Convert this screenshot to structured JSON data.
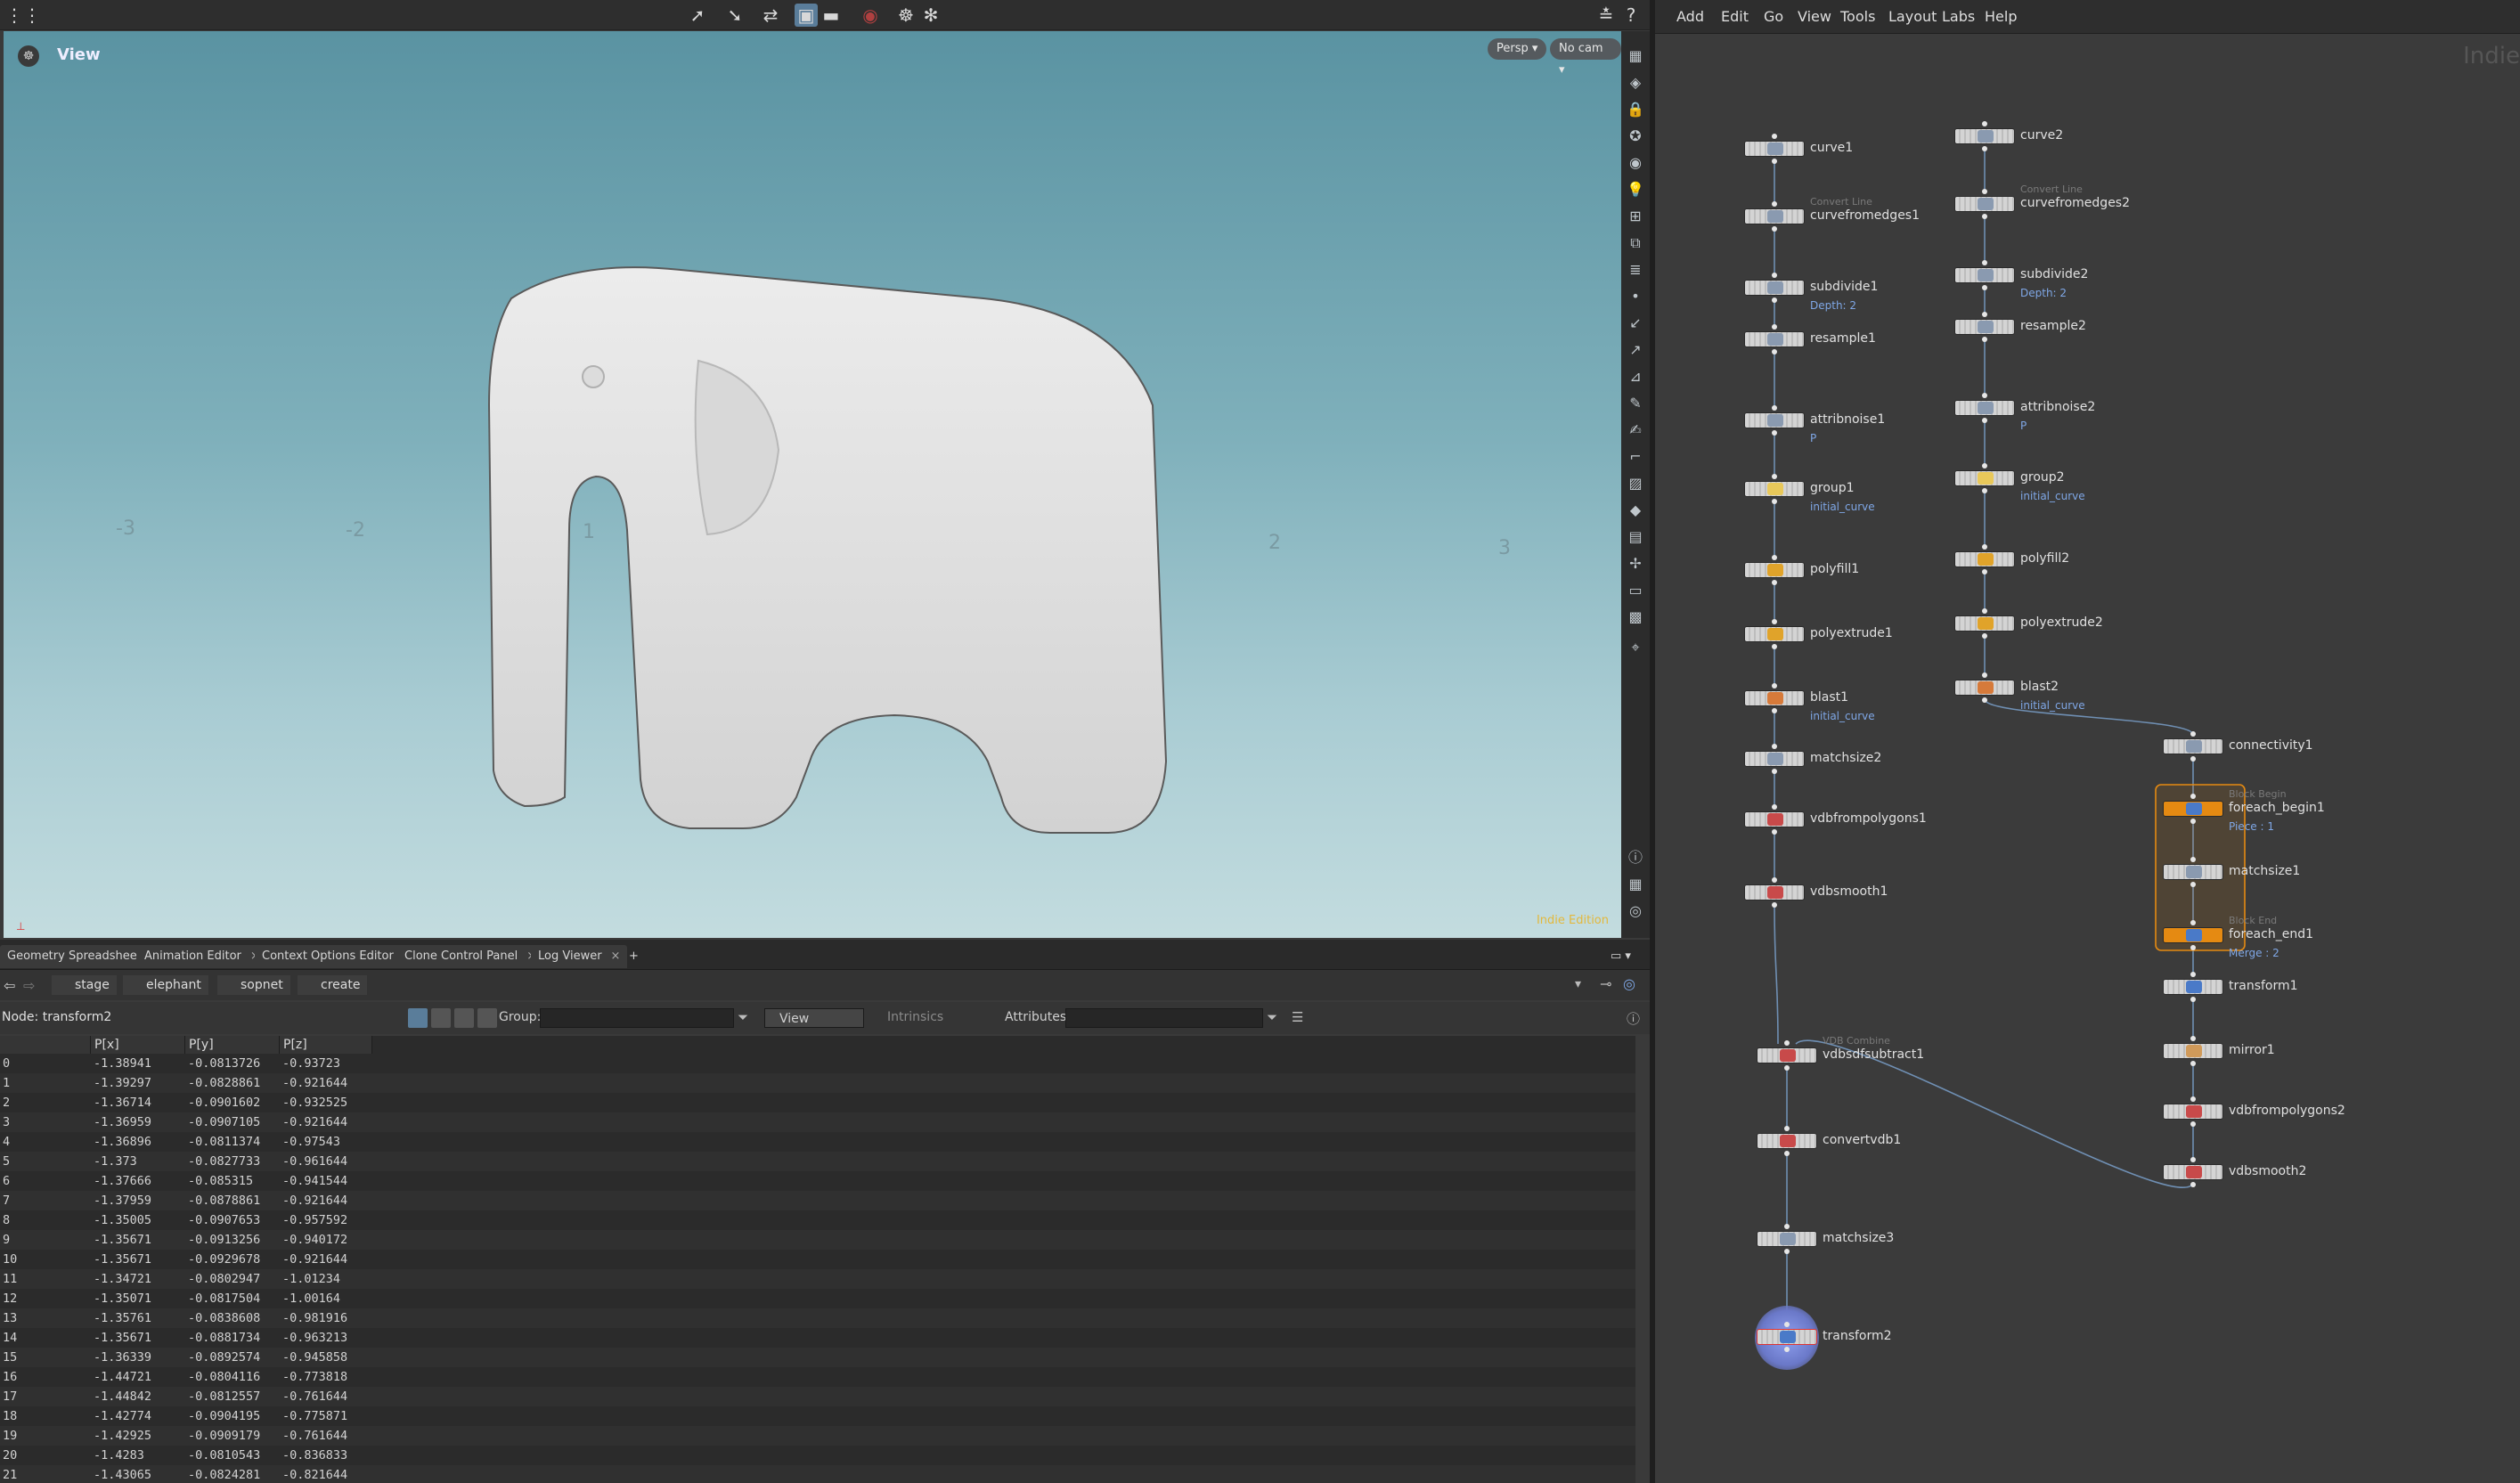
{
  "viewer": {
    "title": "View",
    "persp_label": "Persp ▾",
    "cam_label": "No cam ▾",
    "grid_labels": [
      "-3",
      "-2",
      "1",
      "2",
      "3"
    ],
    "watermark": "Indie Edition",
    "toolbar_icons": [
      "select-icon",
      "transform-icon",
      "handle-icon",
      "snap-icon",
      "view-icon",
      "record-icon",
      "camera-icon",
      "settings-icon"
    ]
  },
  "pane_tabs": [
    {
      "label": "Geometry Spreadsheet"
    },
    {
      "label": "Animation Editor"
    },
    {
      "label": "Context Options Editor"
    },
    {
      "label": "Clone Control Panel"
    },
    {
      "label": "Log Viewer"
    }
  ],
  "path": [
    "stage",
    "elephant",
    "sopnet",
    "create"
  ],
  "spreadsheet": {
    "node_label": "Node: transform2",
    "group_label": "Group:",
    "view_label": "View",
    "intrinsics_label": "Intrinsics",
    "attributes_label": "Attributes:",
    "columns": [
      "",
      "P[x]",
      "P[y]",
      "P[z]"
    ],
    "rows": [
      [
        "0",
        "-1.38941",
        "-0.0813726",
        "-0.93723"
      ],
      [
        "1",
        "-1.39297",
        "-0.0828861",
        "-0.921644"
      ],
      [
        "2",
        "-1.36714",
        "-0.0901602",
        "-0.932525"
      ],
      [
        "3",
        "-1.36959",
        "-0.0907105",
        "-0.921644"
      ],
      [
        "4",
        "-1.36896",
        "-0.0811374",
        "-0.97543"
      ],
      [
        "5",
        "-1.373",
        "-0.0827733",
        "-0.961644"
      ],
      [
        "6",
        "-1.37666",
        "-0.085315",
        "-0.941544"
      ],
      [
        "7",
        "-1.37959",
        "-0.0878861",
        "-0.921644"
      ],
      [
        "8",
        "-1.35005",
        "-0.0907653",
        "-0.957592"
      ],
      [
        "9",
        "-1.35671",
        "-0.0913256",
        "-0.940172"
      ],
      [
        "10",
        "-1.35671",
        "-0.0929678",
        "-0.921644"
      ],
      [
        "11",
        "-1.34721",
        "-0.0802947",
        "-1.01234"
      ],
      [
        "12",
        "-1.35071",
        "-0.0817504",
        "-1.00164"
      ],
      [
        "13",
        "-1.35761",
        "-0.0838608",
        "-0.981916"
      ],
      [
        "14",
        "-1.35671",
        "-0.0881734",
        "-0.963213"
      ],
      [
        "15",
        "-1.36339",
        "-0.0892574",
        "-0.945858"
      ],
      [
        "16",
        "-1.44721",
        "-0.0804116",
        "-0.773818"
      ],
      [
        "17",
        "-1.44842",
        "-0.0812557",
        "-0.761644"
      ],
      [
        "18",
        "-1.42774",
        "-0.0904195",
        "-0.775871"
      ],
      [
        "19",
        "-1.42925",
        "-0.0909179",
        "-0.761644"
      ],
      [
        "20",
        "-1.4283",
        "-0.0810543",
        "-0.836833"
      ],
      [
        "21",
        "-1.43065",
        "-0.0824281",
        "-0.821644"
      ]
    ]
  },
  "network": {
    "menu": [
      "Add",
      "Edit",
      "Go",
      "View",
      "Tools",
      "Layout",
      "Labs",
      "Help"
    ],
    "watermark": "Indie",
    "nodes": [
      {
        "name": "curve1",
        "sub": "",
        "type": ""
      },
      {
        "name": "curvefromedges1",
        "sub": "",
        "type": "Convert Line"
      },
      {
        "name": "subdivide1",
        "sub": "Depth: 2",
        "type": ""
      },
      {
        "name": "resample1",
        "sub": "",
        "type": ""
      },
      {
        "name": "attribnoise1",
        "sub": "P",
        "type": ""
      },
      {
        "name": "group1",
        "sub": "initial_curve",
        "type": ""
      },
      {
        "name": "polyfill1",
        "sub": "",
        "type": ""
      },
      {
        "name": "polyextrude1",
        "sub": "",
        "type": ""
      },
      {
        "name": "blast1",
        "sub": "initial_curve",
        "type": ""
      },
      {
        "name": "matchsize2",
        "sub": "",
        "type": ""
      },
      {
        "name": "vdbfrompolygons1",
        "sub": "",
        "type": ""
      },
      {
        "name": "vdbsmooth1",
        "sub": "",
        "type": ""
      },
      {
        "name": "curve2",
        "sub": "",
        "type": ""
      },
      {
        "name": "curvefromedges2",
        "sub": "",
        "type": "Convert Line"
      },
      {
        "name": "subdivide2",
        "sub": "Depth: 2",
        "type": ""
      },
      {
        "name": "resample2",
        "sub": "",
        "type": ""
      },
      {
        "name": "attribnoise2",
        "sub": "P",
        "type": ""
      },
      {
        "name": "group2",
        "sub": "initial_curve",
        "type": ""
      },
      {
        "name": "polyfill2",
        "sub": "",
        "type": ""
      },
      {
        "name": "polyextrude2",
        "sub": "",
        "type": ""
      },
      {
        "name": "blast2",
        "sub": "initial_curve",
        "type": ""
      },
      {
        "name": "connectivity1",
        "sub": "",
        "type": ""
      },
      {
        "name": "foreach_begin1",
        "sub": "Piece : 1",
        "type": "Block Begin"
      },
      {
        "name": "matchsize1",
        "sub": "",
        "type": ""
      },
      {
        "name": "foreach_end1",
        "sub": "Merge : 2",
        "type": "Block End"
      },
      {
        "name": "transform1",
        "sub": "",
        "type": ""
      },
      {
        "name": "mirror1",
        "sub": "",
        "type": ""
      },
      {
        "name": "vdbfrompolygons2",
        "sub": "",
        "type": ""
      },
      {
        "name": "vdbsmooth2",
        "sub": "",
        "type": ""
      },
      {
        "name": "vdbsdfsubtract1",
        "sub": "",
        "type": "VDB Combine"
      },
      {
        "name": "convertvdb1",
        "sub": "",
        "type": ""
      },
      {
        "name": "matchsize3",
        "sub": "",
        "type": ""
      },
      {
        "name": "transform2",
        "sub": "",
        "type": ""
      }
    ]
  },
  "colors": {
    "accent": "#7fa7e6",
    "block": "#e58a12",
    "selected": "#6a78c8",
    "watermark": "#e3b83c"
  }
}
